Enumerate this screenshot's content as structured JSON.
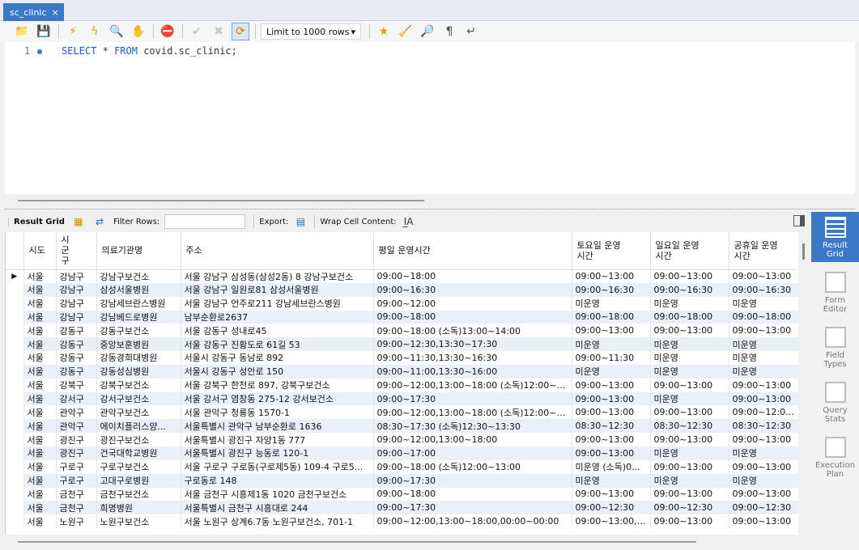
{
  "tab": {
    "title": "sc_clinic",
    "close": "×"
  },
  "toolbar": {
    "limit_label": "Limit to 1000 rows"
  },
  "editor": {
    "line_number": "1",
    "sql": {
      "select": "SELECT",
      "star": "*",
      "from": "FROM",
      "target": "covid.sc_clinic;"
    }
  },
  "result_toolbar": {
    "result_grid": "Result Grid",
    "filter_rows": "Filter Rows:",
    "export": "Export:",
    "wrap_cell": "Wrap Cell Content:"
  },
  "side_panel": [
    {
      "label": "Result\nGrid",
      "active": true
    },
    {
      "label": "Form\nEditor",
      "active": false
    },
    {
      "label": "Field\nTypes",
      "active": false
    },
    {
      "label": "Query\nStats",
      "active": false
    },
    {
      "label": "Execution\nPlan",
      "active": false
    }
  ],
  "grid": {
    "columns": [
      "시도",
      "시\n군\n구",
      "의료기관명",
      "주소",
      "평일 운영시간",
      "토요일 운영\n시간",
      "일요일 운영\n시간",
      "공휴일 운영\n시간"
    ],
    "rows": [
      [
        "서울",
        "강남구",
        "강남구보건소",
        "서울 강남구 삼성동(삼성2동) 8 강남구보건소",
        "09:00~18:00",
        "09:00~13:00",
        "09:00~13:00",
        "09:00~13:00"
      ],
      [
        "서울",
        "강남구",
        "삼성서울병원",
        "서울 강남구 일원로81 삼성서울병원",
        "09:00~16:30",
        "09:00~16:30",
        "09:00~16:30",
        "09:00~16:30"
      ],
      [
        "서울",
        "강남구",
        "강남세브란스병원",
        "서울 강남구 언주로211 강남세브란스병원",
        "09:00~12:00",
        "미운영",
        "미운영",
        "미운영"
      ],
      [
        "서울",
        "강남구",
        "강남베드로병원",
        "남부순환로2637",
        "09:00~18:00",
        "09:00~18:00",
        "09:00~18:00",
        "09:00~18:00"
      ],
      [
        "서울",
        "강동구",
        "강동구보건소",
        "서울 강동구 성내로45",
        "09:00~18:00 (소독)13:00~14:00",
        "09:00~13:00",
        "09:00~13:00",
        "09:00~13:00"
      ],
      [
        "서울",
        "강동구",
        "중앙보훈병원",
        "서울 강동구 진황도로 61길 53",
        "09:00~12:30,13:30~17:30",
        "미운영",
        "미운영",
        "미운영"
      ],
      [
        "서울",
        "강동구",
        "강동경희대병원",
        "서울시 강동구 동남로 892",
        "09:00~11:30,13:30~16:30",
        "09:00~11:30",
        "미운영",
        "미운영"
      ],
      [
        "서울",
        "강동구",
        "강동성심병원",
        "서울시 강동구 성안로 150",
        "09:00~11:00,13:30~16:00",
        "미운영",
        "미운영",
        "미운영"
      ],
      [
        "서울",
        "강북구",
        "강북구보건소",
        "서울 강북구 한천로 897, 강북구보건소",
        "09:00~12:00,13:00~18:00 (소독)12:00~13:00",
        "09:00~13:00",
        "09:00~13:00",
        "09:00~13:00"
      ],
      [
        "서울",
        "강서구",
        "강서구보건소",
        "서울 강서구 염창동 275-12 강서보건소",
        "09:00~17:30",
        "09:00~13:00",
        "미운영",
        "09:00~13:00"
      ],
      [
        "서울",
        "관악구",
        "관악구보건소",
        "서울 관악구 청룡동 1570-1",
        "09:00~12:00,13:00~18:00 (소독)12:00~13:00",
        "09:00~13:00",
        "09:00~13:00",
        "09:00~12:00,1..."
      ],
      [
        "서울",
        "관악구",
        "에이치플러스양...",
        "서울특별시 관악구 남부순환로 1636",
        "08:30~17:30 (소독)12:30~13:30",
        "08:30~12:30",
        "08:30~12:30",
        "08:30~12:30"
      ],
      [
        "서울",
        "광진구",
        "광진구보건소",
        "서울특별시 광진구 자양1동 777",
        "09:00~12:00,13:00~18:00",
        "09:00~13:00",
        "09:00~13:00",
        "09:00~13:00"
      ],
      [
        "서울",
        "광진구",
        "건국대학교병원",
        "서울특별시 광진구 능동로 120-1",
        "09:00~17:00",
        "09:00~13:00",
        "미운영",
        "미운영"
      ],
      [
        "서울",
        "구로구",
        "구로구보건소",
        "서울 구로구 구로동(구로제5동) 109-4 구로5...",
        "09:00~18:00 (소독)12:00~13:00",
        "미운영 (소독)0...",
        "09:00~13:00",
        "09:00~13:00"
      ],
      [
        "서울",
        "구로구",
        "고대구로병원",
        "구로동로 148",
        "09:00~17:30",
        "미운영",
        "미운영",
        "미운영"
      ],
      [
        "서울",
        "금천구",
        "금천구보건소",
        "서울 금천구 시흥제1동 1020 금천구보건소",
        "09:00~18:00",
        "09:00~13:00",
        "09:00~13:00",
        "09:00~13:00"
      ],
      [
        "서울",
        "금천구",
        "희명병원",
        "서울특별시 금천구 시흥대로 244",
        "09:00~17:30",
        "09:00~12:30",
        "09:00~12:30",
        "09:00~12:30"
      ],
      [
        "서울",
        "노원구",
        "노원구보건소",
        "서울 노원구 상계6.7동 노원구보건소, 701-1",
        "09:00~12:00,13:00~18:00,00:00~00:00",
        "09:00~13:00,0...",
        "09:00~13:00",
        "09:00~13:00"
      ]
    ]
  }
}
